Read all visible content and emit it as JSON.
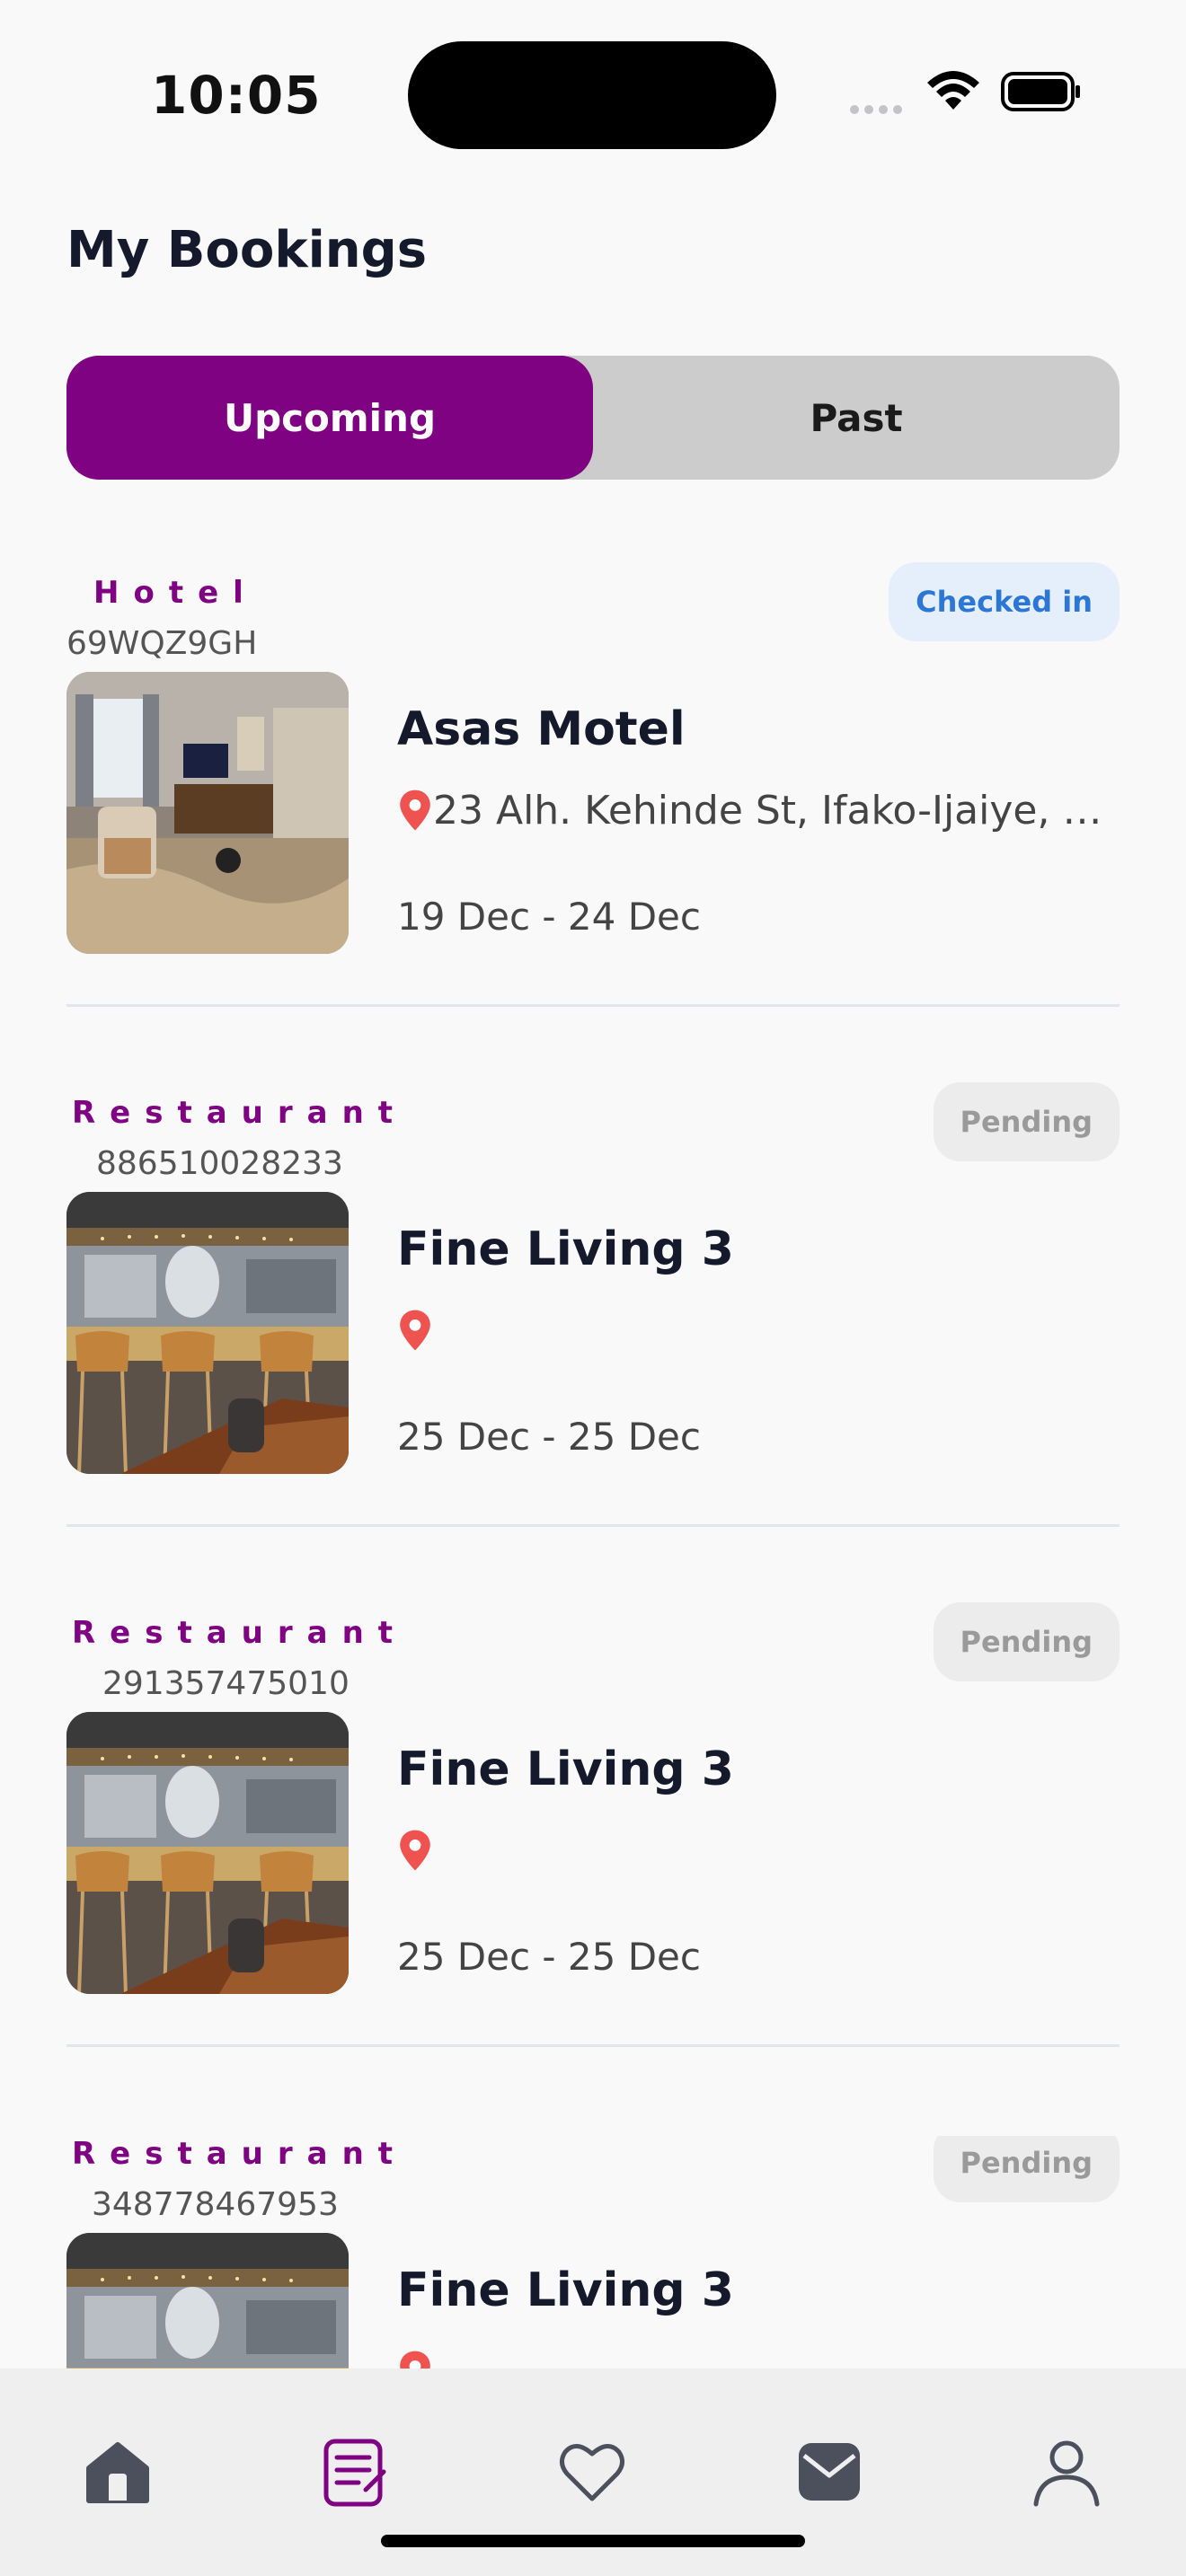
{
  "status_bar": {
    "time": "10:05"
  },
  "header": {
    "title": "My Bookings"
  },
  "tabs": {
    "upcoming": "Upcoming",
    "past": "Past",
    "selected": "Upcoming"
  },
  "colors": {
    "accent": "#7e0281",
    "checked_in_bg": "#e5effb",
    "checked_in_text": "#2c77d6",
    "pending_bg": "#ececed",
    "pending_text": "#9a9a9a",
    "pin": "#ef5350"
  },
  "bookings": [
    {
      "category": "Hotel",
      "code": "69WQZ9GH",
      "status": "Checked in",
      "name": "Asas Motel",
      "address": "23 Alh. Kehinde St, Ifako-Ijaiye, Age...",
      "dates": "19 Dec - 24 Dec",
      "image": "hotel-room-photo"
    },
    {
      "category": "Restaurant",
      "code": "886510028233",
      "status": "Pending",
      "name": "Fine Living 3",
      "address": "",
      "dates": "25 Dec - 25 Dec",
      "image": "restaurant-bar-photo"
    },
    {
      "category": "Restaurant",
      "code": "291357475010",
      "status": "Pending",
      "name": "Fine Living 3",
      "address": "",
      "dates": "25 Dec - 25 Dec",
      "image": "restaurant-bar-photo"
    },
    {
      "category": "Restaurant",
      "code": "348778467953",
      "status": "Pending",
      "name": "Fine Living 3",
      "address": "",
      "dates": "",
      "image": "restaurant-bar-photo"
    }
  ],
  "bottom_nav": [
    {
      "icon": "home-icon",
      "active": false
    },
    {
      "icon": "bookings-icon",
      "active": true
    },
    {
      "icon": "heart-icon",
      "active": false
    },
    {
      "icon": "inbox-icon",
      "active": false
    },
    {
      "icon": "profile-icon",
      "active": false
    }
  ]
}
